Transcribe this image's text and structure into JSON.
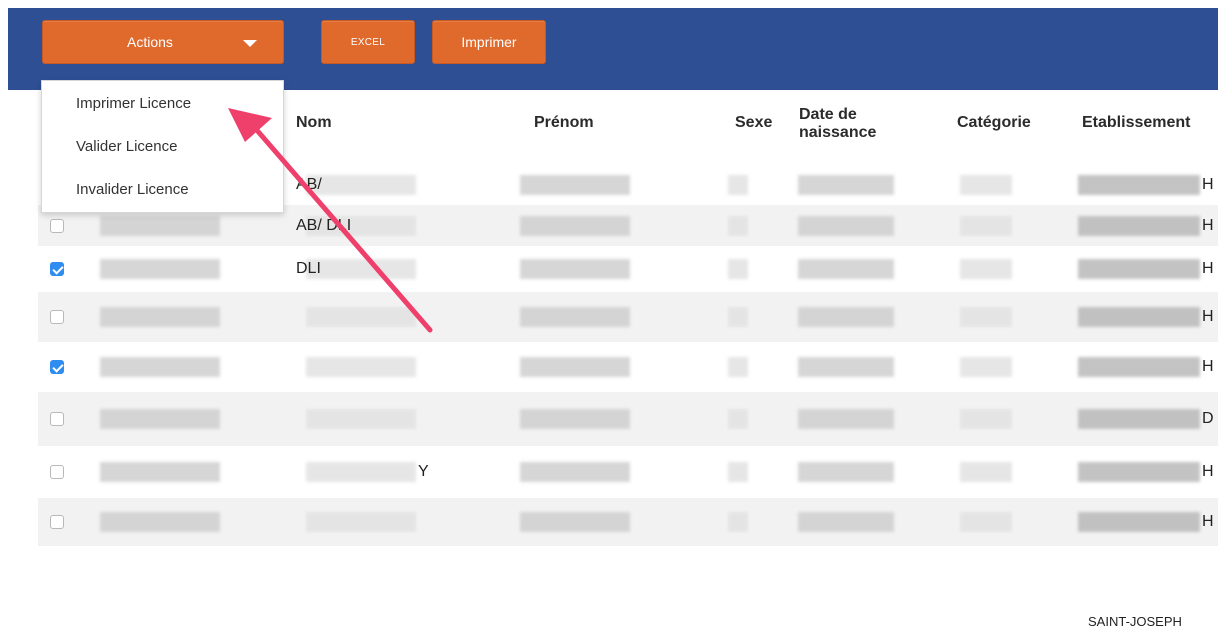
{
  "toolbar": {
    "actions_label": "Actions",
    "excel_label": "EXCEL",
    "print_label": "Imprimer"
  },
  "actions_menu": {
    "items": [
      "Imprimer Licence",
      "Valider Licence",
      "Invalider Licence"
    ]
  },
  "table": {
    "headers": {
      "nom": "Nom",
      "prenom": "Prénom",
      "sexe": "Sexe",
      "date_naissance": "Date de naissance",
      "categorie": "Catégorie",
      "etablissement": "Etablissement"
    },
    "rows": [
      {
        "checked": null,
        "nom": "AB/",
        "etab": "H"
      },
      {
        "checked": false,
        "nom": "AB/ DLI",
        "etab": "H"
      },
      {
        "checked": true,
        "nom": "DLI",
        "etab": "H"
      },
      {
        "checked": false,
        "nom": "",
        "etab": "H"
      },
      {
        "checked": true,
        "nom": "",
        "etab": "H"
      },
      {
        "checked": false,
        "nom": "",
        "etab": "D"
      },
      {
        "checked": false,
        "nom": "Y",
        "etab": "H"
      },
      {
        "checked": false,
        "nom": "",
        "etab": "H"
      }
    ],
    "partial_row_etab": "SAINT-JOSEPH"
  },
  "colors": {
    "toolbar_bg": "#2f4f95",
    "button_bg": "#e0692c",
    "checkbox_checked": "#2f8cf0",
    "annotation_arrow": "#ef3f6b"
  },
  "icons": {
    "dropdown": "chevron-down-icon",
    "annotation": "arrow-icon"
  }
}
